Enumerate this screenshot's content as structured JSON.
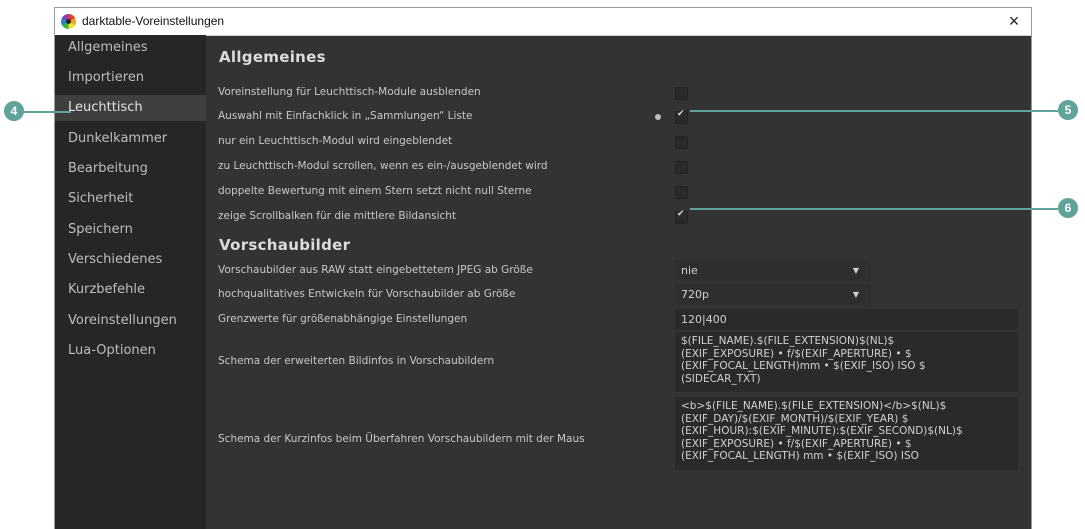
{
  "window": {
    "title": "darktable-Voreinstellungen",
    "close_glyph": "×"
  },
  "sidebar": {
    "items": [
      {
        "label": "Allgemeines"
      },
      {
        "label": "Importieren"
      },
      {
        "label": "Leuchttisch",
        "active": true
      },
      {
        "label": "Dunkelkammer"
      },
      {
        "label": "Bearbeitung"
      },
      {
        "label": "Sicherheit"
      },
      {
        "label": "Speichern"
      },
      {
        "label": "Verschiedenes"
      },
      {
        "label": "Kurzbefehle"
      },
      {
        "label": "Voreinstellungen"
      },
      {
        "label": "Lua-Optionen"
      }
    ]
  },
  "general": {
    "title": "Allgemeines",
    "rows": [
      {
        "label": "Voreinstellung für Leuchttisch-Module ausblenden",
        "checked": false
      },
      {
        "label": "Auswahl mit Einfachklick in „Sammlungen“ Liste",
        "checked": true,
        "changed": true
      },
      {
        "label": "nur ein Leuchttisch-Modul wird eingeblendet",
        "checked": false
      },
      {
        "label": "zu Leuchttisch-Modul scrollen, wenn es ein-/ausgeblendet wird",
        "checked": false
      },
      {
        "label": "doppelte Bewertung mit einem Stern setzt nicht null Sterne",
        "checked": false
      },
      {
        "label": "zeige Scrollbalken für die mittlere Bildansicht",
        "checked": true
      }
    ]
  },
  "thumbnails": {
    "title": "Vorschaubilder",
    "raw_label": "Vorschaubilder aus RAW statt eingebettetem JPEG ab Größe",
    "raw_value": "nie",
    "hq_label": "hochqualitatives Entwickeln für Vorschaubilder ab Größe",
    "hq_value": "720p",
    "limits_label": "Grenzwerte für größenabhängige Einstellungen",
    "limits_value": "120|400",
    "ext_label": "Schema der erweiterten Bildinfos in Vorschaubildern",
    "ext_value": "$(FILE_NAME).$(FILE_EXTENSION)$(NL)$\n(EXIF_EXPOSURE) • f/$(EXIF_APERTURE) • $\n(EXIF_FOCAL_LENGTH)mm • $(EXIF_ISO) ISO $\n(SIDECAR_TXT)",
    "tooltip_label": "Schema der Kurzinfos beim Überfahren Vorschaubildern mit der Maus",
    "tooltip_value": "<b>$(FILE_NAME).$(FILE_EXTENSION)</b>$(NL)$\n(EXIF_DAY)/$(EXIF_MONTH)/$(EXIF_YEAR) $\n(EXIF_HOUR):$(EXIF_MINUTE):$(EXIF_SECOND)$(NL)$\n(EXIF_EXPOSURE) • f/$(EXIF_APERTURE) • $\n(EXIF_FOCAL_LENGTH) mm • $(EXIF_ISO) ISO"
  },
  "callouts": {
    "c4": "4",
    "c5": "5",
    "c6": "6"
  },
  "icons": {
    "app": "darktable-logo-icon",
    "close": "close-icon",
    "dropdown": "chevron-down-icon"
  },
  "colors": {
    "callout": "#5fa39a",
    "background": "#333333",
    "sidebar": "#262626"
  }
}
